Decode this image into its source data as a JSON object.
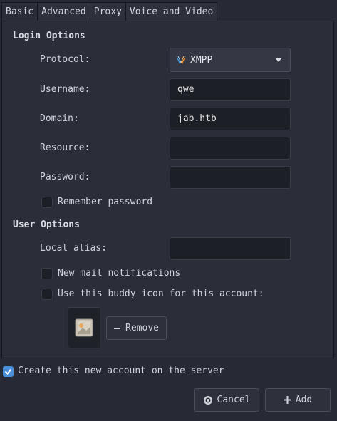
{
  "tabs": [
    {
      "label": "Basic",
      "active": true
    },
    {
      "label": "Advanced",
      "active": false
    },
    {
      "label": "Proxy",
      "active": false
    },
    {
      "label": "Voice and Video",
      "active": false
    }
  ],
  "login_options": {
    "title": "Login Options",
    "protocol": {
      "label": "Protocol:",
      "value": "XMPP",
      "icon": "xmpp-icon"
    },
    "username": {
      "label": "Username:",
      "value": "qwe"
    },
    "domain": {
      "label": "Domain:",
      "value": "jab.htb"
    },
    "resource": {
      "label": "Resource:",
      "value": ""
    },
    "password": {
      "label": "Password:",
      "value": ""
    },
    "remember_password": {
      "label": "Remember password",
      "checked": false
    }
  },
  "user_options": {
    "title": "User Options",
    "local_alias": {
      "label": "Local alias:",
      "value": ""
    },
    "new_mail": {
      "label": "New mail notifications",
      "checked": false
    },
    "buddy_icon": {
      "label": "Use this buddy icon for this account:",
      "checked": false
    },
    "remove_label": "Remove"
  },
  "create_account": {
    "label": "Create this new account on the server",
    "checked": true
  },
  "buttons": {
    "cancel_label": "Cancel",
    "add_label": "Add"
  },
  "colors": {
    "accent": "#4a90d9",
    "background": "#272a34",
    "field": "#1d1f26"
  }
}
